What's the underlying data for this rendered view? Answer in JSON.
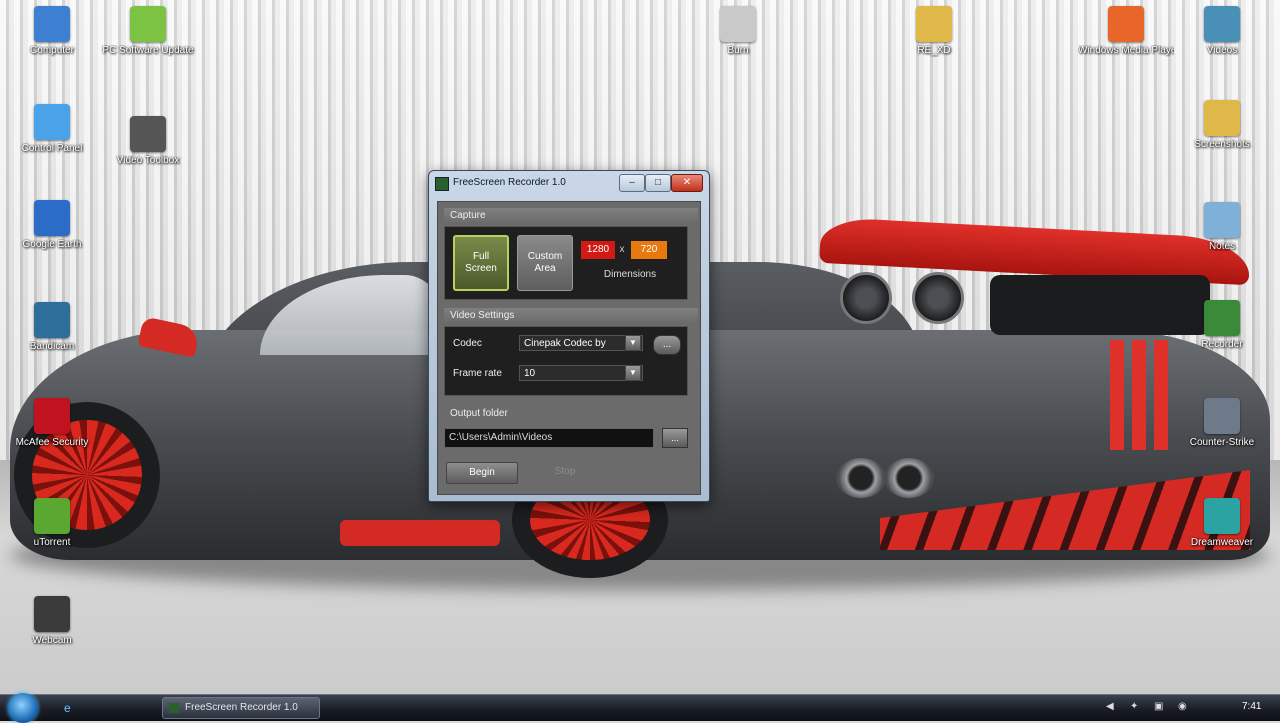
{
  "desktop_icons": [
    {
      "id": "computer",
      "label": "Computer",
      "color": "#3d7fd0"
    },
    {
      "id": "pc-software-update",
      "label": "PC Software Update",
      "color": "#7cc243"
    },
    {
      "id": "burn",
      "label": "Burn",
      "color": "#c9c9c9"
    },
    {
      "id": "folder-1",
      "label": "RE_XD",
      "color": "#e0b84a"
    },
    {
      "id": "media-player",
      "label": "Windows Media Player",
      "color": "#e8662a"
    },
    {
      "id": "videos",
      "label": "Videos",
      "color": "#4a8fb8"
    },
    {
      "id": "control-panel",
      "label": "Control Panel",
      "color": "#4aa3e8"
    },
    {
      "id": "video-app",
      "label": "Video Toolbox",
      "color": "#555555"
    },
    {
      "id": "folder-2",
      "label": "Screenshots",
      "color": "#e0b84a"
    },
    {
      "id": "google-earth",
      "label": "Google Earth",
      "color": "#2b6cc8"
    },
    {
      "id": "notes",
      "label": "Notes",
      "color": "#7fb0d8"
    },
    {
      "id": "bandicam",
      "label": "Bandicam",
      "color": "#2d6e9a"
    },
    {
      "id": "recorder",
      "label": "Recorder",
      "color": "#3a8a3a"
    },
    {
      "id": "mcafee",
      "label": "McAfee Security",
      "color": "#c1121f"
    },
    {
      "id": "counter-strike",
      "label": "Counter-Strike",
      "color": "#6c7a89"
    },
    {
      "id": "utorrent",
      "label": "uTorrent",
      "color": "#5aa832"
    },
    {
      "id": "dreamweaver",
      "label": "Dreamweaver",
      "color": "#2ba3a3"
    },
    {
      "id": "webcam",
      "label": "Webcam",
      "color": "#3b3b3b"
    }
  ],
  "dialog": {
    "title": "FreeScreen Recorder 1.0",
    "minimize_label": "–",
    "maximize_label": "□",
    "close_label": "✕",
    "capture": {
      "header": "Capture",
      "full_screen_label": "Full Screen",
      "custom_area_label": "Custom Area",
      "width": "1280",
      "times": "x",
      "height": "720",
      "dimensions_label": "Dimensions"
    },
    "video_settings": {
      "header": "Video Settings",
      "codec_label": "Codec",
      "codec_value": "Cinepak Codec by",
      "settings_button": "...",
      "frame_rate_label": "Frame rate",
      "frame_rate_value": "10",
      "arrow": "▼"
    },
    "output": {
      "header": "Output folder",
      "path": "C:\\Users\\Admin\\Videos",
      "browse_label": "..."
    },
    "begin_label": "Begin",
    "stop_label": "Stop"
  },
  "taskbar": {
    "quick_launch_icon": "e",
    "active_task": "FreeScreen Recorder 1.0",
    "tray_icons": [
      "◀",
      "✦",
      "▣",
      "◉"
    ],
    "clock": "7:41"
  }
}
